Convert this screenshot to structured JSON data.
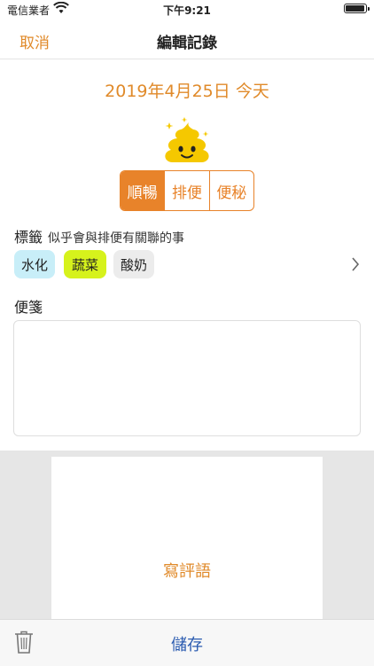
{
  "status_bar": {
    "carrier": "電信業者",
    "time": "下午9:21",
    "battery_level": 0.9
  },
  "nav": {
    "cancel_label": "取消",
    "title": "編輯記錄"
  },
  "date_text": "2019年4月25日 今天",
  "mood_icon": "smiling-poop-icon",
  "segment": {
    "options": [
      "順暢",
      "排便",
      "便秘"
    ],
    "selected": "順暢"
  },
  "tags": {
    "heading": "標籤",
    "subheading": "似乎會與排便有關聯的事",
    "items": [
      {
        "label": "水化",
        "color": "#c8eef8"
      },
      {
        "label": "蔬菜",
        "color": "#d6f21c"
      },
      {
        "label": "酸奶",
        "color": "#ececec"
      }
    ]
  },
  "note": {
    "heading": "便箋",
    "value": ""
  },
  "comment_label": "寫評語",
  "bottom": {
    "save_label": "儲存",
    "delete_icon": "trash-icon"
  },
  "colors": {
    "accent": "#e8832a",
    "save": "#2a5bb0"
  }
}
